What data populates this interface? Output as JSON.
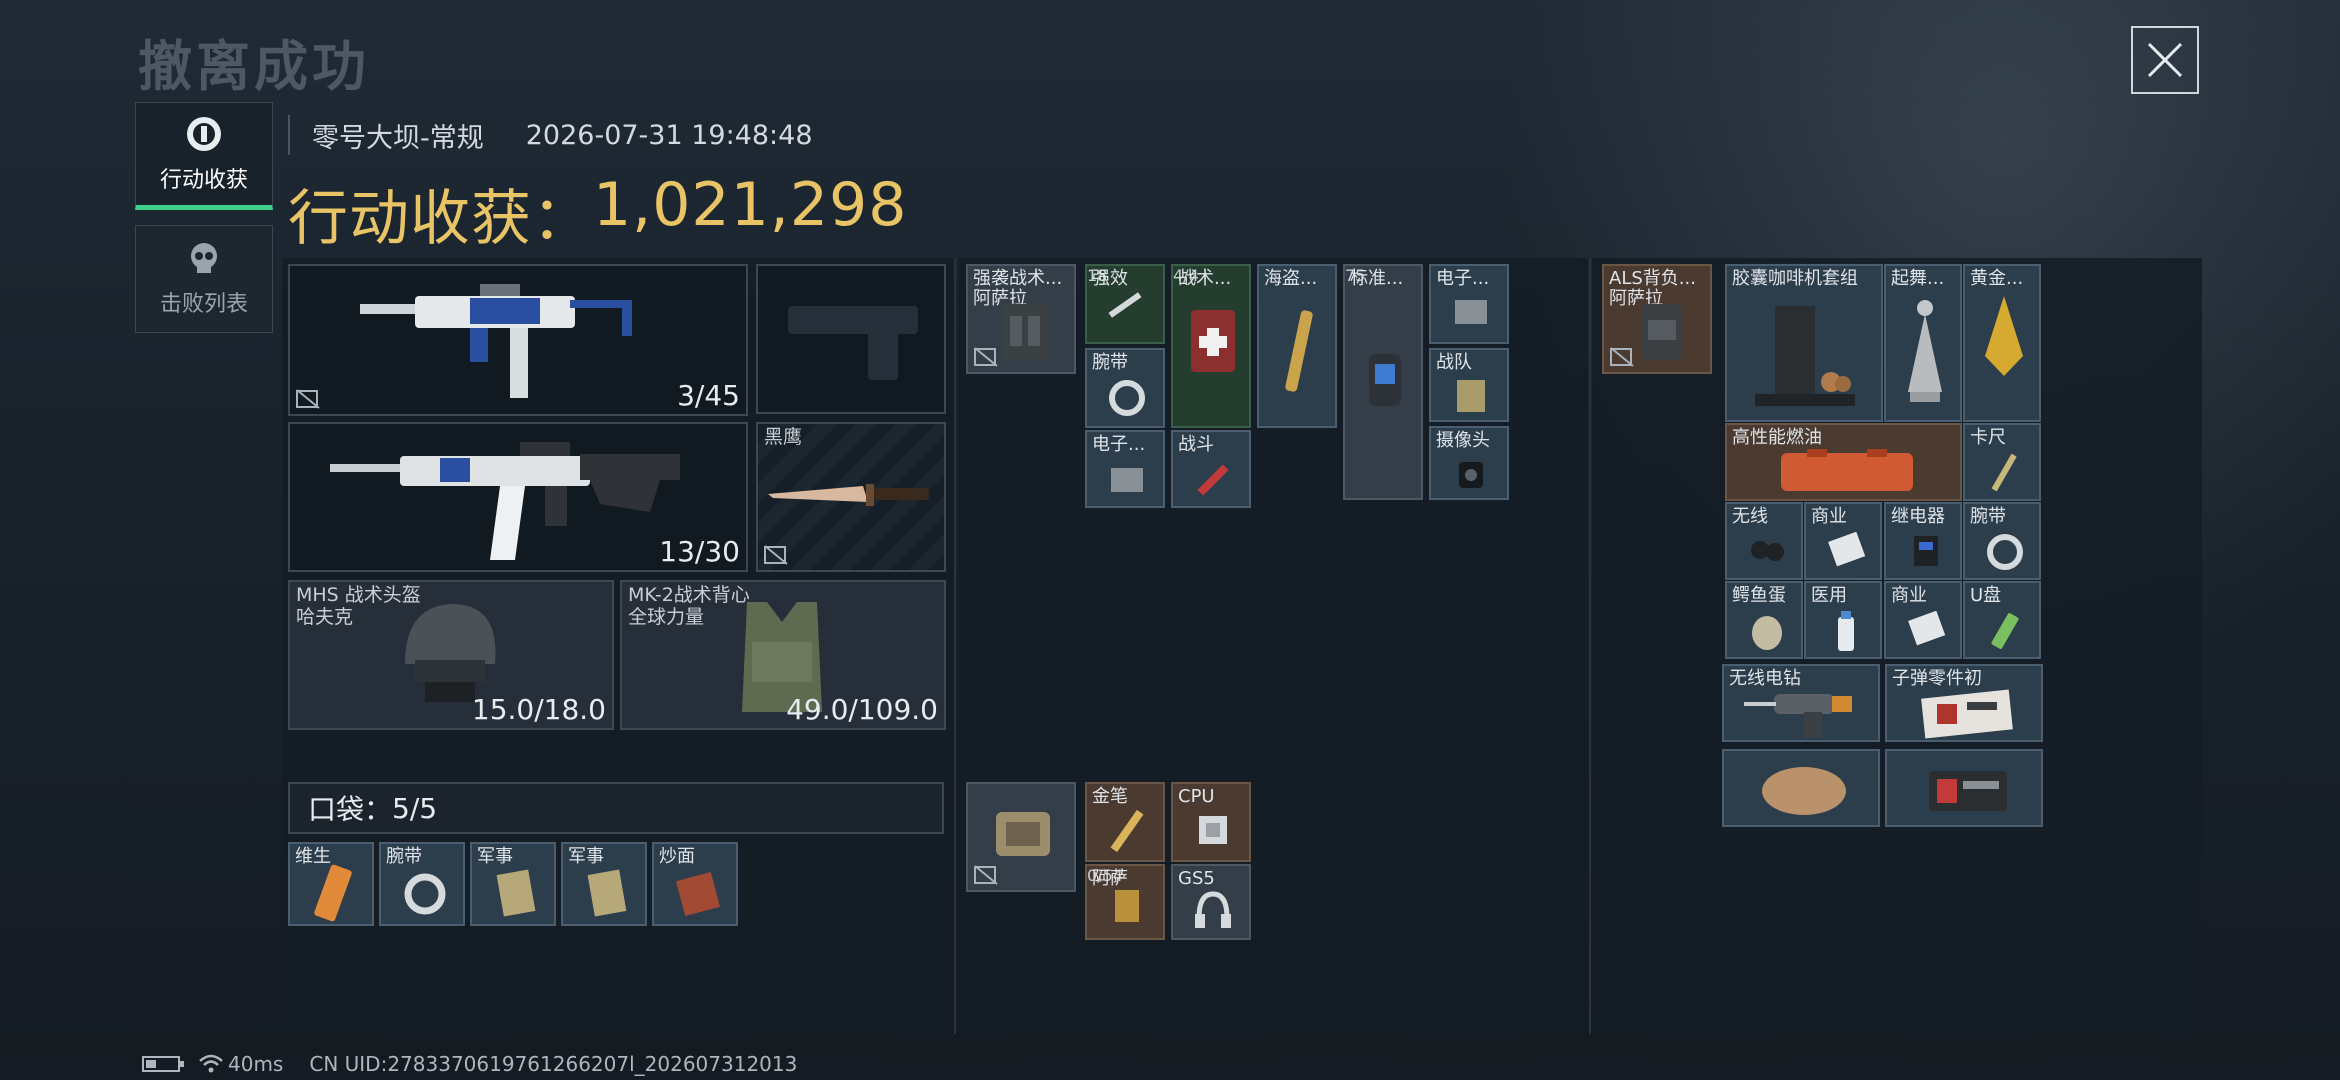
{
  "title": "撤离成功",
  "sidebar": {
    "tab_loot": "行动收获",
    "tab_kills": "击败列表"
  },
  "header": {
    "map_mode": "零号大坝-常规",
    "datetime": "2026-07-31 19:48:48",
    "loot_label": "行动收获：",
    "loot_value": "1,021,298"
  },
  "equipment": {
    "primary_weapon_ammo": "3/45",
    "secondary_weapon_ammo": "13/30",
    "melee_label": "黑鹰",
    "helmet_name": "MHS 战术头盔",
    "helmet_brand": "哈夫克",
    "helmet_durability": "15.0/18.0",
    "armor_name": "MK-2战术背心",
    "armor_brand": "全球力量",
    "armor_durability": "49.0/109.0",
    "pocket_label": "口袋：",
    "pocket_count": "5/5",
    "pocket_items": [
      "维生",
      "腕带",
      "军事",
      "军事",
      "炒面"
    ]
  },
  "chest_rig": {
    "rig_label": "强袭战术...",
    "rig_brand": "阿萨拉",
    "items": {
      "a": "强效",
      "a_count": "18",
      "b": "战术...",
      "b_count": "4/4",
      "c": "海盗...",
      "d": "标准...",
      "d_count": "75",
      "e": "电子...",
      "f": "腕带",
      "g": "战队",
      "h": "电子...",
      "i": "战斗",
      "j": "摄像头"
    },
    "case_items": {
      "gold": "金笔",
      "cpu": "CPU",
      "ammo": "阿萨",
      "ammo_count": "0/54",
      "gs5": "GS5"
    }
  },
  "backpack": {
    "label": "ALS背负...",
    "brand": "阿萨拉",
    "items": [
      "胶囊咖啡机套组",
      "起舞...",
      "黄金...",
      "高性能燃油",
      "卡尺",
      "无线",
      "商业",
      "继电器",
      "腕带",
      "鳄鱼蛋",
      "医用",
      "商业",
      "U盘",
      "无线电钻",
      "子弹零件初"
    ]
  },
  "status": {
    "ping": "40ms",
    "uid": "CN UID:2783370619761266207l_202607312013"
  },
  "colors": {
    "accent_green": "#3fcf8b",
    "gold_text": "#e8c467"
  }
}
